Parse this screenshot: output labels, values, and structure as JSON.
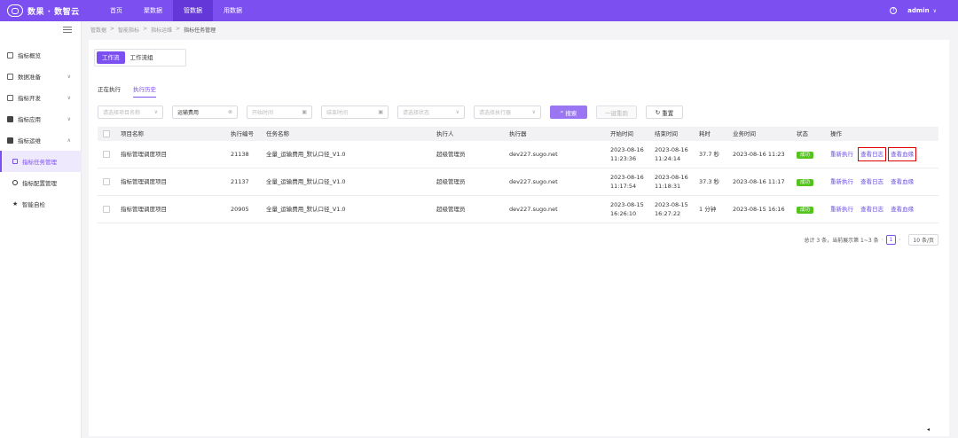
{
  "brand": {
    "name": "数果 · 数智云"
  },
  "nav": [
    {
      "label": "首页"
    },
    {
      "label": "聚数据"
    },
    {
      "label": "管数据"
    },
    {
      "label": "用数据"
    }
  ],
  "user": {
    "name": "admin",
    "help": "?"
  },
  "sidebar": {
    "items": [
      {
        "label": "指标概览",
        "caret": ""
      },
      {
        "label": "数据准备",
        "caret": "∨"
      },
      {
        "label": "指标开发",
        "caret": "∨"
      },
      {
        "label": "指标应用",
        "caret": "∨"
      },
      {
        "label": "指标运维",
        "caret": "∧"
      }
    ],
    "subitems": [
      {
        "label": "指标任务管理",
        "icon": "▤"
      },
      {
        "label": "指标配置管理",
        "icon": "◎"
      },
      {
        "label": "智能自检",
        "icon": "★"
      }
    ]
  },
  "breadcrumb": [
    "管数据",
    "智能指标",
    "指标运维",
    "指标任务管理"
  ],
  "breadcrumb_sep": ">",
  "seg_tabs": [
    "工作流",
    "工作流组"
  ],
  "sub_tabs": [
    "正在执行",
    "执行历史"
  ],
  "filters": {
    "project": "请选择项目名称",
    "task": "运输费用",
    "start": "开始时间",
    "end": "结束时间",
    "status": "请选择状态",
    "executor": "请选择执行器",
    "search_btn": "搜索",
    "batch_btn": "一键重跑",
    "reset_btn": "重置"
  },
  "table": {
    "headers": [
      "项目名称",
      "执行编号",
      "任务名称",
      "执行人",
      "执行器",
      "开始时间",
      "结束时间",
      "耗时",
      "业务时间",
      "状态",
      "操作"
    ],
    "rows": [
      {
        "project": "指标管理调度项目",
        "id": "21138",
        "task": "全量_运输费用_默认口径_V1.0",
        "user": "超级管理员",
        "executor": "dev227.sugo.net",
        "start_d": "2023-08-16",
        "start_t": "11:23:36",
        "end_d": "2023-08-16",
        "end_t": "11:24:14",
        "duration": "37.7 秒",
        "biz_time": "2023-08-16 11:23",
        "status": "成功"
      },
      {
        "project": "指标管理调度项目",
        "id": "21137",
        "task": "全量_运输费用_默认口径_V1.0",
        "user": "超级管理员",
        "executor": "dev227.sugo.net",
        "start_d": "2023-08-16",
        "start_t": "11:17:54",
        "end_d": "2023-08-16",
        "end_t": "11:18:31",
        "duration": "37.3 秒",
        "biz_time": "2023-08-16 11:17",
        "status": "成功"
      },
      {
        "project": "指标管理调度项目",
        "id": "20905",
        "task": "全量_运输费用_默认口径_V1.0",
        "user": "超级管理员",
        "executor": "dev227.sugo.net",
        "start_d": "2023-08-15",
        "start_t": "16:26:10",
        "end_d": "2023-08-15",
        "end_t": "16:27:22",
        "duration": "1 分钟",
        "biz_time": "2023-08-15 16:16",
        "status": "成功"
      }
    ],
    "actions": [
      "重新执行",
      "查看日志",
      "查看血缘"
    ]
  },
  "pager": {
    "summary": "总计 3 条，当前展示第 1~3 条",
    "page": "1",
    "size": "10 条/页"
  },
  "colors": {
    "brand": "#7b4ff0",
    "success": "#52c41a",
    "link": "#6a4fe0"
  }
}
